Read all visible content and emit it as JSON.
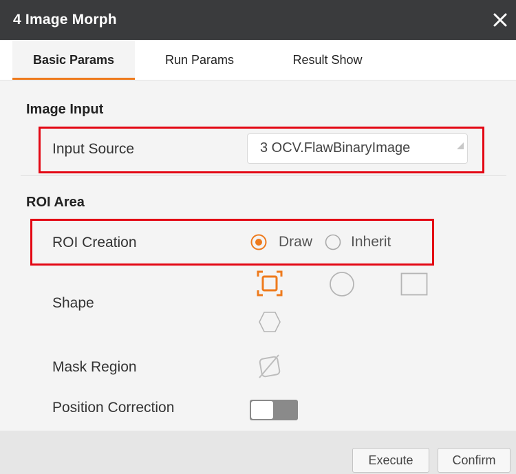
{
  "window": {
    "title": "4 Image Morph",
    "close_icon": "close-icon"
  },
  "tabs": [
    {
      "label": "Basic Params",
      "active": true
    },
    {
      "label": "Run Params",
      "active": false
    },
    {
      "label": "Result Show",
      "active": false
    }
  ],
  "image_input": {
    "section_title": "Image Input",
    "input_source_label": "Input Source",
    "input_source_value": "3 OCV.FlawBinaryImage"
  },
  "roi_area": {
    "section_title": "ROI Area",
    "roi_creation_label": "ROI Creation",
    "options": [
      {
        "label": "Draw",
        "selected": true
      },
      {
        "label": "Inherit",
        "selected": false
      }
    ],
    "shape_label": "Shape",
    "shapes": [
      "rectangle-roi-icon",
      "circle-icon",
      "square-icon",
      "hexagon-icon"
    ],
    "mask_region_label": "Mask Region",
    "mask_icon": "mask-disabled-icon",
    "position_correction_label": "Position Correction",
    "position_correction_on": false
  },
  "footer": {
    "execute_label": "Execute",
    "confirm_label": "Confirm"
  },
  "colors": {
    "accent": "#ee7a1c",
    "highlight": "#e30613",
    "titlebar": "#3a3b3d"
  }
}
